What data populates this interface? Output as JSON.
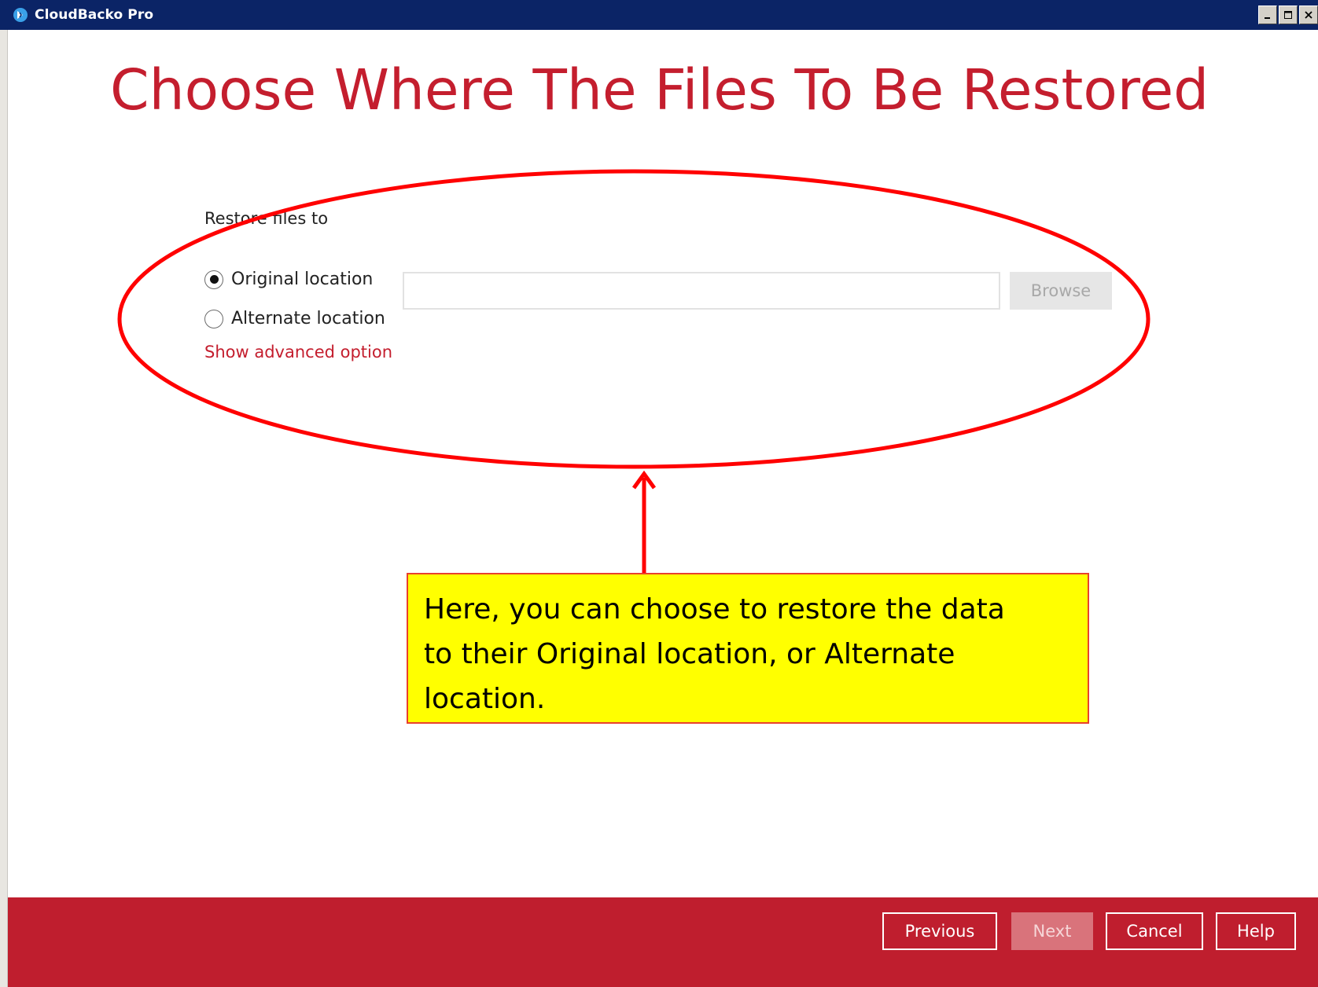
{
  "window": {
    "title": "CloudBacko Pro",
    "icon": "cloudbacko-logo-icon",
    "controls": [
      "minimize-icon",
      "maximize-icon",
      "close-icon"
    ]
  },
  "page": {
    "title": "Choose Where The Files To Be Restored"
  },
  "restore": {
    "label": "Restore files to",
    "options": [
      {
        "label": "Original location",
        "selected": true
      },
      {
        "label": "Alternate location",
        "selected": false
      }
    ],
    "alternate_path_value": "",
    "browse_label": "Browse",
    "advanced_link": "Show advanced option"
  },
  "annotation": {
    "callout_text": "Here, you can choose to restore the data to their Original location, or Alternate location.",
    "callout_line1": "Here, you can choose to restore the data",
    "callout_line2": "to their Original location, or Alternate",
    "callout_line3": "location.",
    "ellipse_color": "#ff0000",
    "callout_background": "#ffff00"
  },
  "footer": {
    "buttons": [
      {
        "label": "Previous",
        "enabled": true
      },
      {
        "label": "Next",
        "enabled": false
      },
      {
        "label": "Cancel",
        "enabled": true
      },
      {
        "label": "Help",
        "enabled": true
      }
    ]
  },
  "colors": {
    "accent": "#c41e2e",
    "titlebar": "#0b2466",
    "footer": "#bf1e2e"
  }
}
